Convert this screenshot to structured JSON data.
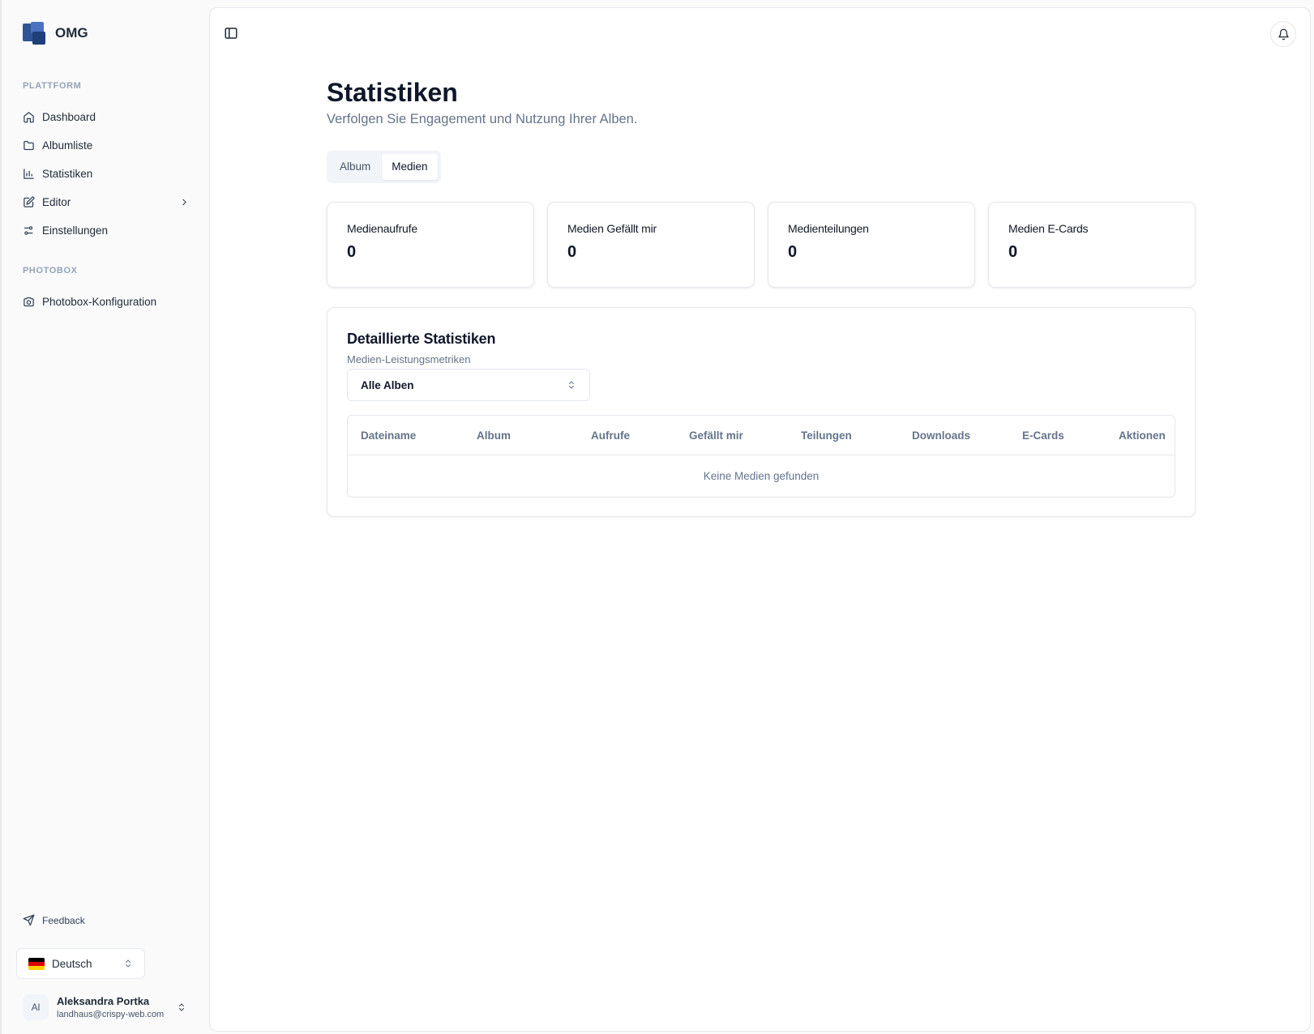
{
  "app": {
    "name": "OMG"
  },
  "sidebar": {
    "sections": [
      {
        "label": "PLATTFORM"
      },
      {
        "label": "PHOTOBOX"
      }
    ],
    "items": [
      {
        "label": "Dashboard",
        "icon": "home-icon"
      },
      {
        "label": "Albumliste",
        "icon": "folder-icon"
      },
      {
        "label": "Statistiken",
        "icon": "bar-chart-icon"
      },
      {
        "label": "Editor",
        "icon": "edit-icon"
      },
      {
        "label": "Einstellungen",
        "icon": "sliders-icon"
      },
      {
        "label": "Photobox-Konfiguration",
        "icon": "camera-icon"
      }
    ],
    "feedback": "Feedback",
    "language": "Deutsch",
    "user": {
      "initials": "Al",
      "name": "Aleksandra Portka",
      "email": "landhaus@crispy-web.com"
    }
  },
  "page": {
    "title": "Statistiken",
    "subtitle": "Verfolgen Sie Engagement und Nutzung Ihrer Alben.",
    "tabs": [
      {
        "label": "Album"
      },
      {
        "label": "Medien"
      }
    ],
    "active_tab": "Medien"
  },
  "stats": [
    {
      "label": "Medienaufrufe",
      "value": "0"
    },
    {
      "label": "Medien Gefällt mir",
      "value": "0"
    },
    {
      "label": "Medienteilungen",
      "value": "0"
    },
    {
      "label": "Medien E-Cards",
      "value": "0"
    }
  ],
  "detail": {
    "title": "Detaillierte Statistiken",
    "subtitle": "Medien-Leistungsmetriken",
    "select_value": "Alle Alben",
    "columns": [
      "Dateiname",
      "Album",
      "Aufrufe",
      "Gefällt mir",
      "Teilungen",
      "Downloads",
      "E-Cards",
      "Aktionen"
    ],
    "empty_text": "Keine Medien gefunden"
  },
  "colors": {
    "brand": "#2f5597",
    "muted": "#64748b",
    "border": "#e5e7eb"
  }
}
